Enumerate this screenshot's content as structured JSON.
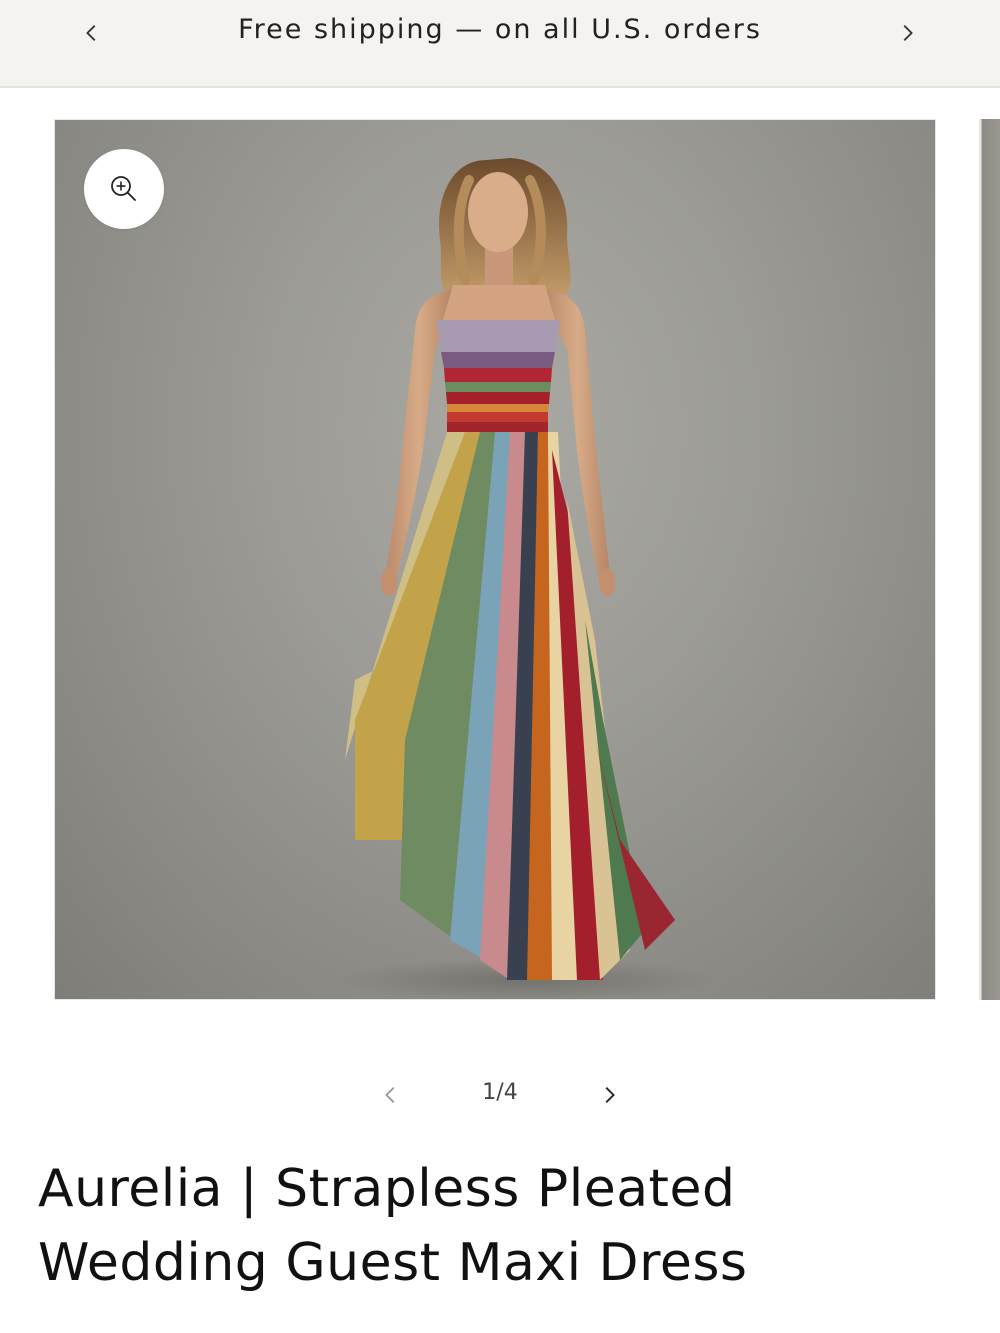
{
  "announcement": {
    "text": "Free shipping — on all U.S. orders",
    "prev_icon": "chevron-left-icon",
    "next_icon": "chevron-right-icon"
  },
  "gallery": {
    "zoom_icon": "zoom-in-icon",
    "image_subject": "model in strapless pleated multicolor striped maxi dress",
    "pager": {
      "text": "1/4",
      "current": 1,
      "total": 4,
      "prev_icon": "chevron-left-icon",
      "next_icon": "chevron-right-icon"
    }
  },
  "product": {
    "title": "Aurelia | Strapless Pleated Wedding Guest Maxi Dress"
  },
  "colors": {
    "announcement_bg": "#f4f3ef",
    "photo_bg": "#9c9b96",
    "text": "#1a1a1a"
  }
}
